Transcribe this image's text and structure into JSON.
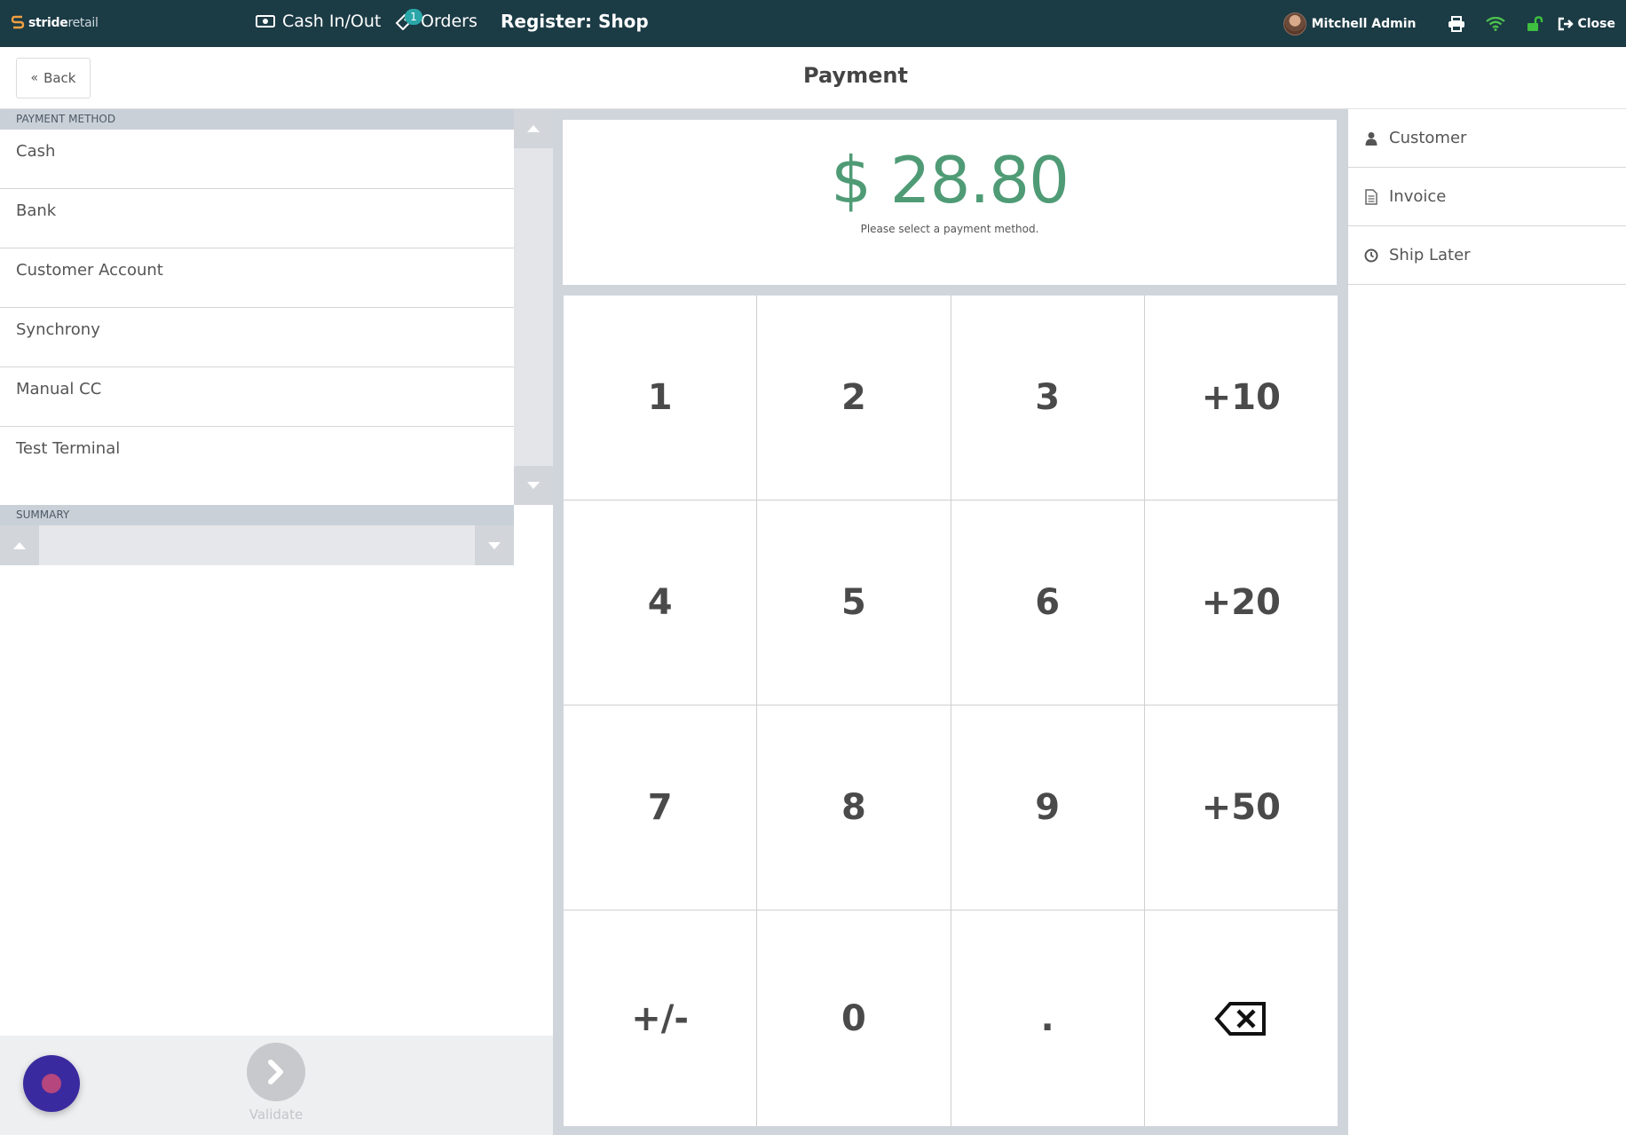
{
  "topbar": {
    "logo_bold": "stride",
    "logo_light": "retail",
    "cash_label": "Cash In/Out",
    "orders_label": "Orders",
    "orders_badge": "1",
    "register_title": "Register: Shop",
    "user_name": "Mitchell Admin",
    "close_label": "Close",
    "icons": [
      "cash-icon",
      "orders-icon",
      "printer-icon",
      "wifi-icon",
      "lock-icon",
      "sign-out-icon"
    ]
  },
  "header": {
    "back_label": "Back",
    "title": "Payment"
  },
  "payment_methods": {
    "section_label": "PAYMENT METHOD",
    "items": [
      "Cash",
      "Bank",
      "Customer Account",
      "Synchrony",
      "Manual CC",
      "Test Terminal"
    ]
  },
  "summary": {
    "section_label": "SUMMARY"
  },
  "footer": {
    "validate_label": "Validate"
  },
  "amount": {
    "value": "$ 28.80",
    "hint": "Please select a payment method.",
    "color": "#4f9b76"
  },
  "keypad": {
    "keys": [
      "1",
      "2",
      "3",
      "+10",
      "4",
      "5",
      "6",
      "+20",
      "7",
      "8",
      "9",
      "+50",
      "+/-",
      "0",
      "."
    ]
  },
  "right_actions": {
    "customer_label": "Customer",
    "invoice_label": "Invoice",
    "ship_later_label": "Ship Later"
  },
  "colors": {
    "topbar": "#1b3b45",
    "badge": "#2aa6a8",
    "wifi": "#4cc04c",
    "lock": "#3fbf3f",
    "fab": "#3a2aa0"
  }
}
